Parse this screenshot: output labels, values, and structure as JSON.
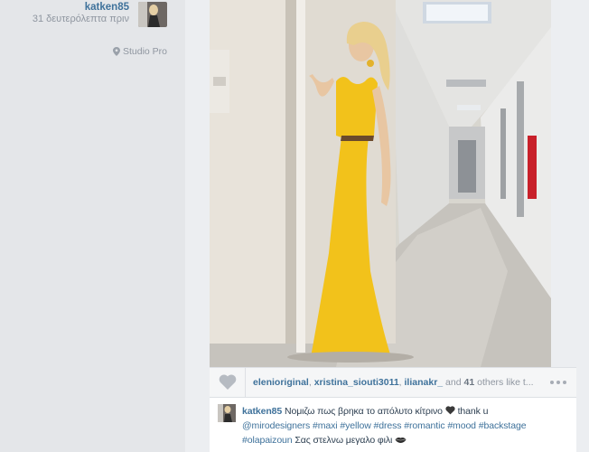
{
  "post": {
    "username": "katken85",
    "time": "31 δευτερόλεπτα πριν",
    "location": "Studio Pro"
  },
  "likes": {
    "users": [
      "elenioriginal",
      "xristina_siouti3011",
      "ilianakr_"
    ],
    "sep": ", ",
    "and_text": " and ",
    "others_count": "41",
    "others_text": " others like t..."
  },
  "comment": {
    "username": "katken85",
    "text_before": "Νομιζω πως βρηκα το απόλυτο κίτρινο",
    "thank": "thank u",
    "mention": "@mirodesigners",
    "tags": [
      "#maxi",
      "#yellow",
      "#dress",
      "#romantic",
      "#mood",
      "#backstage",
      "#olapaizoun"
    ],
    "text_after": "Σας στελνω μεγαλο φιλι"
  },
  "colors": {
    "link": "#3f729b",
    "muted": "#8f96a0",
    "dress": "#f2c21b"
  },
  "icons": [
    "location-pin-icon",
    "heart-icon",
    "more-icon",
    "black-heart-emoji",
    "lips-emoji"
  ]
}
